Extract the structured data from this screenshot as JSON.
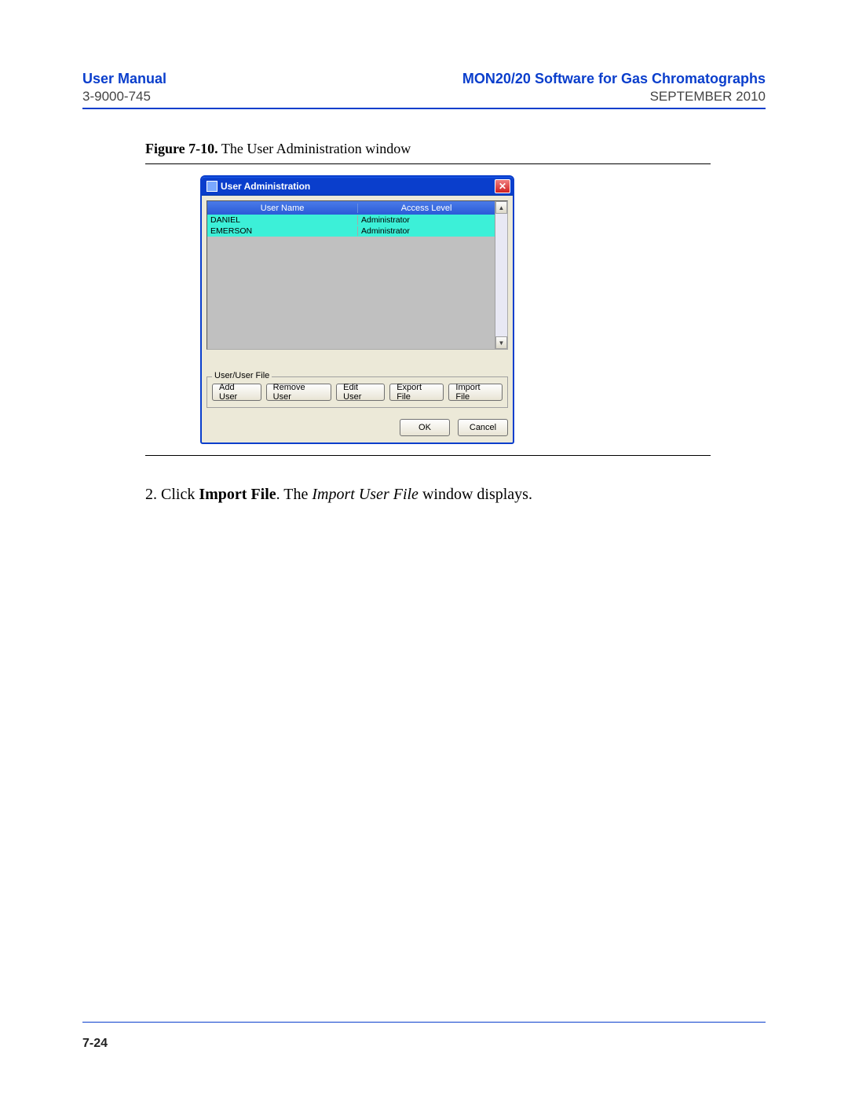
{
  "header": {
    "left": "User Manual",
    "right": "MON20/20 Software for Gas Chromatographs",
    "subleft": "3-9000-745",
    "subright": "SEPTEMBER 2010"
  },
  "figure": {
    "label": "Figure 7-10.",
    "caption": " The User Administration window"
  },
  "window": {
    "title": "User Administration",
    "close": "✕",
    "columns": {
      "user_name": "User Name",
      "access_level": "Access Level"
    },
    "rows": [
      {
        "user": "DANIEL",
        "level": "Administrator"
      },
      {
        "user": "EMERSON",
        "level": "Administrator"
      }
    ],
    "scroll_up": "▲",
    "scroll_down": "▼",
    "fieldset_legend": "User/User File",
    "buttons": {
      "add_user": "Add User",
      "remove_user": "Remove User",
      "edit_user": "Edit User",
      "export_file": "Export File",
      "import_file": "Import File"
    },
    "ok": "OK",
    "cancel": "Cancel"
  },
  "instruction": {
    "number": "2.",
    "pre": "Click ",
    "bold": "Import File",
    "mid": ".  The ",
    "italic": "Import User File",
    "post": " window displays."
  },
  "footer": {
    "page": "7-24"
  }
}
